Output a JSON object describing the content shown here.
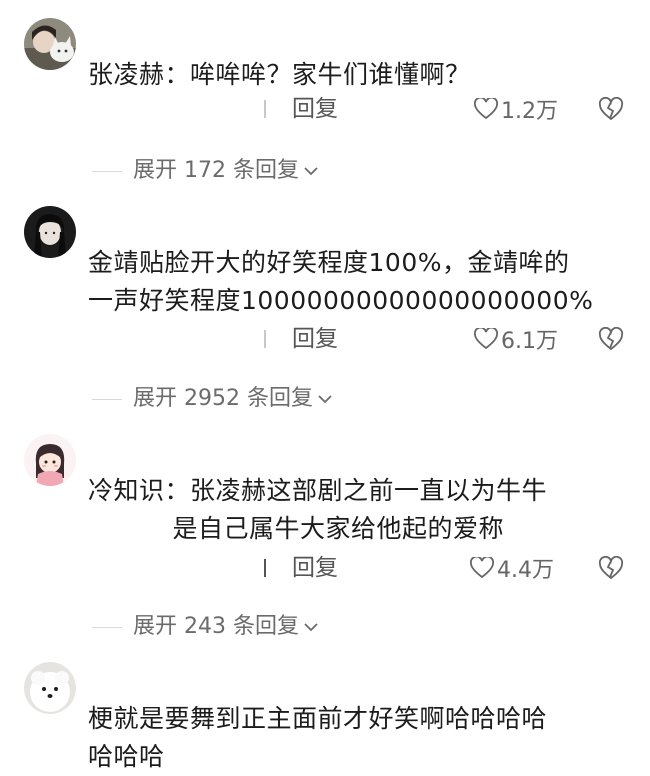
{
  "comments": [
    {
      "author_avatar": "cat-girl-avatar",
      "text": "张凌赫：哞哞哞？家牛们谁懂啊？",
      "reply_label": "回复",
      "likes": "1.2万",
      "expand_label": "展开 172 条回复"
    },
    {
      "author_avatar": "dark-hair-girl-avatar",
      "text": "金靖贴脸开大的好笑程度100%，金靖哞的\n一声好笑程度10000000000000000000%",
      "reply_label": "回复",
      "likes": "6.1万",
      "expand_label": "展开 2952 条回复"
    },
    {
      "author_avatar": "cartoon-girl-avatar",
      "text": "冷知识：张凌赫这部剧之前一直以为牛牛\n          是自己属牛大家给他起的爱称",
      "reply_label": "回复",
      "likes": "4.4万",
      "expand_label": "展开 243 条回复"
    },
    {
      "author_avatar": "white-dog-avatar",
      "text": "梗就是要舞到正主面前才好笑啊哈哈哈哈\n哈哈哈"
    }
  ],
  "colors": {
    "text": "#1c1c1c",
    "secondary": "#666666",
    "divider": "#d9d9d9"
  }
}
